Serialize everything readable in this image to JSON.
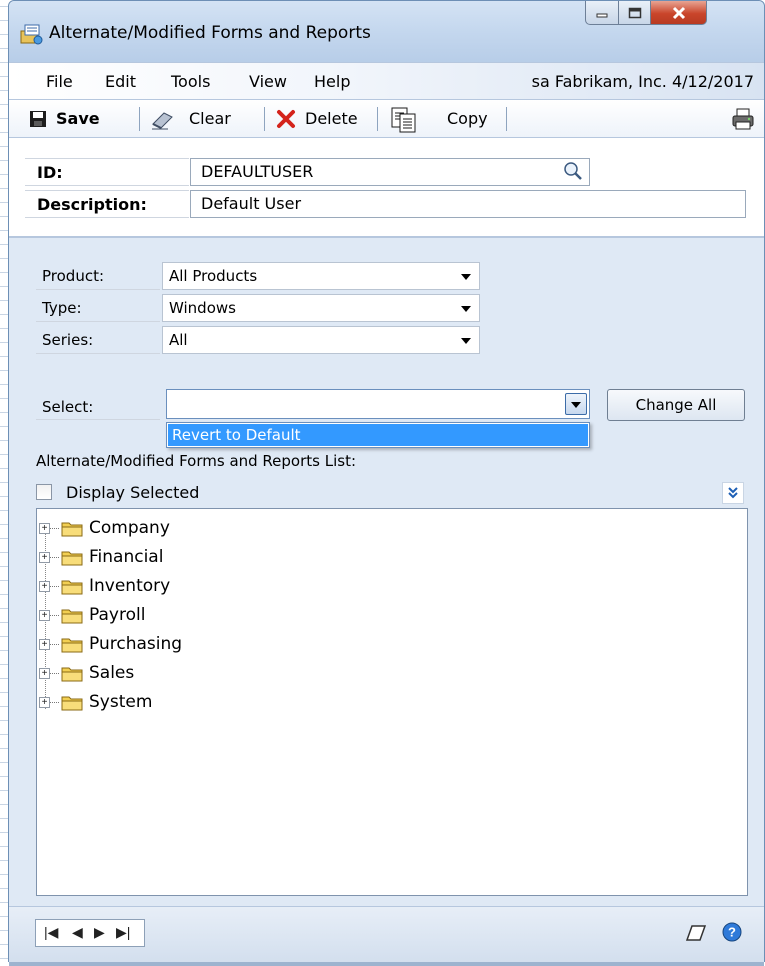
{
  "window": {
    "title": "Alternate/Modified Forms and Reports"
  },
  "menu": {
    "items": [
      "File",
      "Edit",
      "Tools",
      "View",
      "Help"
    ],
    "status": "sa  Fabrikam, Inc. 4/12/2017"
  },
  "toolbar": {
    "save": "Save",
    "clear": "Clear",
    "delete": "Delete",
    "copy": "Copy"
  },
  "header": {
    "id_label": "ID:",
    "id_value": "DEFAULTUSER",
    "description_label": "Description:",
    "description_value": "Default User"
  },
  "filters": {
    "product_label": "Product:",
    "product_value": "All Products",
    "type_label": "Type:",
    "type_value": "Windows",
    "series_label": "Series:",
    "series_value": "All"
  },
  "select": {
    "label": "Select:",
    "value": "",
    "options": [
      "Revert to Default"
    ],
    "change_all": "Change All"
  },
  "list": {
    "title": "Alternate/Modified Forms and Reports List:",
    "display_selected": "Display Selected",
    "display_selected_checked": false,
    "items": [
      "Company",
      "Financial",
      "Inventory",
      "Payroll",
      "Purchasing",
      "Sales",
      "System"
    ]
  },
  "icons": {
    "app": "forms-icon",
    "save": "floppy-disk-icon",
    "clear": "eraser-icon",
    "delete": "red-x-icon",
    "copy": "copy-icon",
    "print": "printer-icon",
    "lookup": "magnifier-icon",
    "note": "note-icon",
    "help": "help-icon"
  },
  "colors": {
    "accent": "#3399ff",
    "delete": "#d4231b",
    "folder": "#f2cf52",
    "close_button": "#c9452b"
  }
}
